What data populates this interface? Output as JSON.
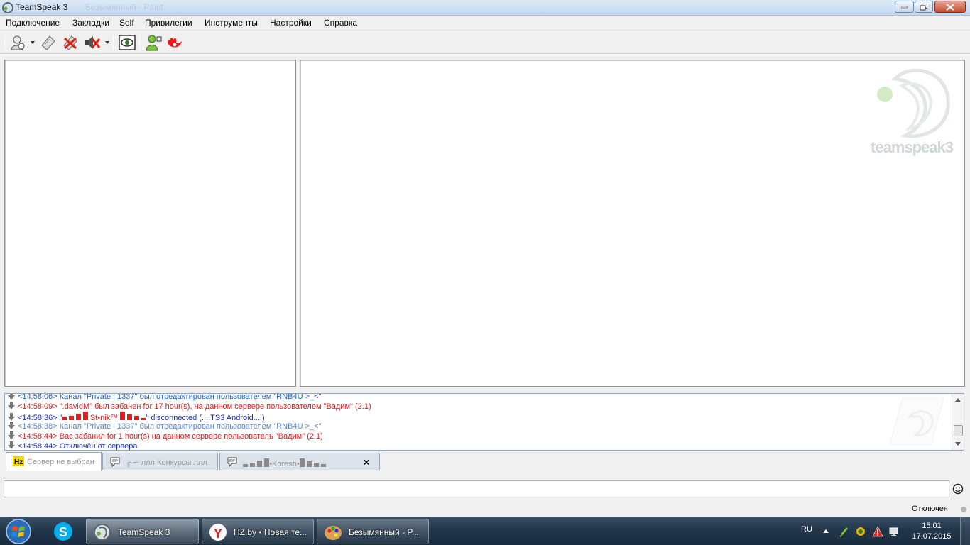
{
  "window": {
    "title": "TeamSpeak 3",
    "background_title": "Безымянный - Paint"
  },
  "menu": [
    "Подключение",
    "Закладки",
    "Self",
    "Привилегии",
    "Инструменты",
    "Настройки",
    "Справка"
  ],
  "toolbar": {
    "icons": [
      "connect-icon",
      "bookmark-icon",
      "disconnect-icon",
      "mute-speakers-icon",
      "away-icon",
      "whisper-icon",
      "channel-commander-icon"
    ]
  },
  "logo": {
    "text": "teamspeak3"
  },
  "log": {
    "lines": [
      {
        "time": "<14:58:06>",
        "text": "Канал \"Private | 1337\" был отредактирован пользователем \"RNB4U >_<\"",
        "color": "#1f62c9"
      },
      {
        "time": "<14:58:09>",
        "prefix": "\".davidM\" был забанен for 17 hour(s), на данном сервере пользователем \"Вадим\" (2.1)",
        "color": "#e31d1d"
      },
      {
        "time": "<14:58:36>",
        "prefix": "\"",
        "middle": ".St•nik™",
        "suffix": "\" disconnected (....TS3 Android....)",
        "color": "#1a2fcc"
      },
      {
        "time": "<14:58:38>",
        "text": "Канал \"Private | 1337\" был отредактирован пользователем \"RNB4U >_<\"",
        "color": "#5a86c9"
      },
      {
        "time": "<14:58:44>",
        "text": "Вас забанил for 1 hour(s) на данном сервере пользователь \"Вадим\" (2.1)",
        "color": "#e31d1d"
      },
      {
        "time": "<14:58:44>",
        "text": "Отключён от сервера",
        "color": "#1a2fcc"
      }
    ]
  },
  "tabs": [
    {
      "label": "Сервер не выбран",
      "active": true
    },
    {
      "label": "╓ ─ ллл Конкурсы ллл"
    },
    {
      "label": "•Koresh•"
    }
  ],
  "input": {
    "value": ""
  },
  "status": {
    "text": "Отключен"
  },
  "taskbar": {
    "tasks": [
      {
        "label": "TeamSpeak 3"
      },
      {
        "label": "HZ.by • Новая те..."
      },
      {
        "label": "Безымянный - P..."
      }
    ],
    "lang": "RU",
    "time": "15:01",
    "date": "17.07.2015"
  }
}
